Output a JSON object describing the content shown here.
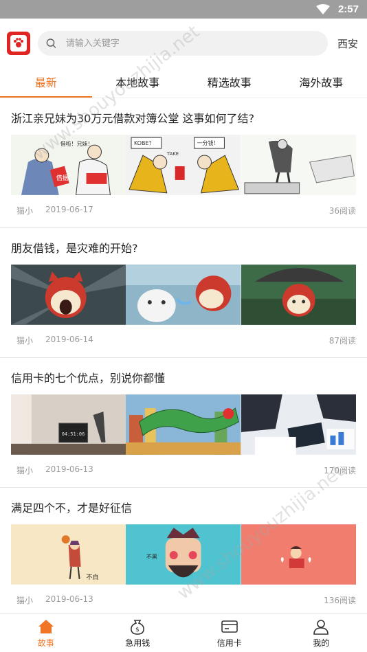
{
  "status_bar": {
    "time": "2:57"
  },
  "header": {
    "search_placeholder": "请输入关键字",
    "city": "西安"
  },
  "tabs": [
    {
      "label": "最新",
      "active": true
    },
    {
      "label": "本地故事",
      "active": false
    },
    {
      "label": "精选故事",
      "active": false
    },
    {
      "label": "海外故事",
      "active": false
    }
  ],
  "articles": [
    {
      "title": "浙江亲兄妹为30万元借款对簿公堂 这事如何了结?",
      "author": "猫小",
      "date": "2019-06-17",
      "reads": "36阅读"
    },
    {
      "title": "朋友借钱，是灾难的开始?",
      "author": "猫小",
      "date": "2019-06-14",
      "reads": "87阅读"
    },
    {
      "title": "信用卡的七个优点，别说你都懂",
      "author": "猫小",
      "date": "2019-06-13",
      "reads": "170阅读"
    },
    {
      "title": "满足四个不，才是好征信",
      "author": "猫小",
      "date": "2019-06-13",
      "reads": "136阅读"
    }
  ],
  "image_texts": {
    "comic_speech_1": "借啦！兄妹！",
    "comic_speech_2": "借据",
    "comic_speech_3": "KOBE？",
    "comic_speech_4": "TAKE",
    "comic_speech_5": "一分钱！",
    "clock_display": "04:51:06",
    "badge_1": "不白",
    "badge_2": "不黑"
  },
  "bottom_nav": [
    {
      "label": "故事",
      "icon": "home-icon",
      "active": true
    },
    {
      "label": "急用钱",
      "icon": "money-bag-icon",
      "active": false
    },
    {
      "label": "信用卡",
      "icon": "credit-card-icon",
      "active": false
    },
    {
      "label": "我的",
      "icon": "person-icon",
      "active": false
    }
  ],
  "watermark": "www.shouyouzhijia.net",
  "colors": {
    "accent": "#f07524",
    "logo_red": "#e02424",
    "status_bar": "#9e9e9e"
  }
}
